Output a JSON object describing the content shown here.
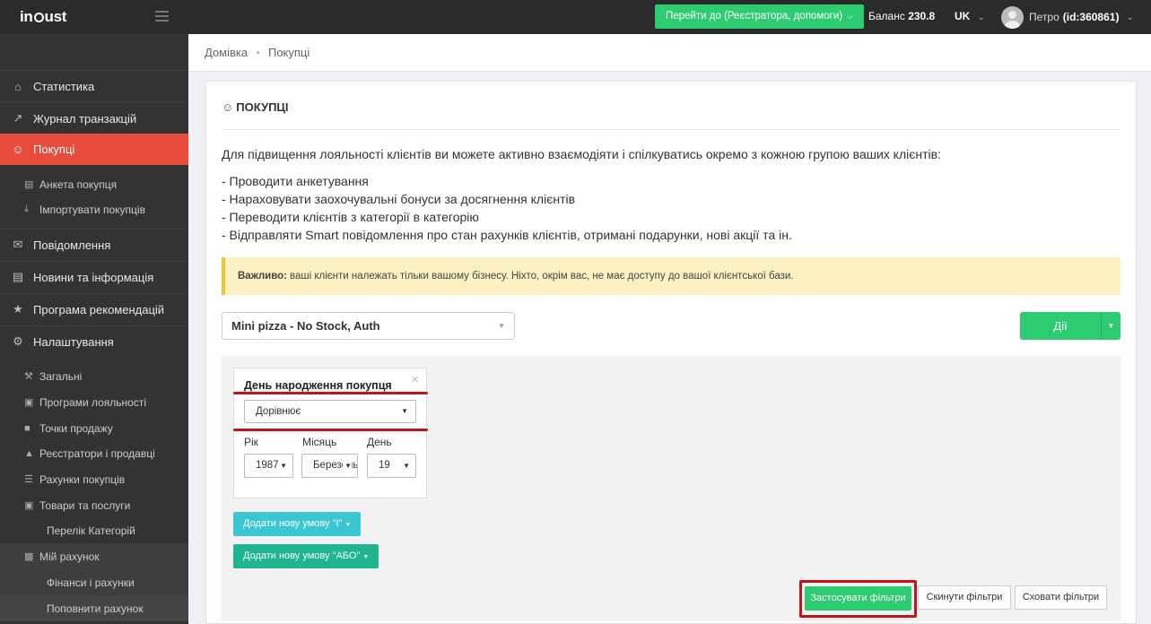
{
  "topbar": {
    "logo": "incust",
    "goto_label": "Перейти до (Реєстратора, допомоги)",
    "balance_label": "Баланс",
    "balance_value": "230.8",
    "lang": "UK",
    "user_name": "Петро",
    "user_id": "(id:360861)"
  },
  "sidebar": {
    "items": [
      {
        "label": "Статистика",
        "icon": "home-icon"
      },
      {
        "label": "Журнал транзакцій",
        "icon": "chart-line-icon"
      },
      {
        "label": "Покупці",
        "icon": "users-icon"
      },
      {
        "label": "Анкета покупця",
        "icon": "document-icon"
      },
      {
        "label": "Імпортувати покупців",
        "icon": "download-icon"
      },
      {
        "label": "Повідомлення",
        "icon": "message-icon"
      },
      {
        "label": "Новини та інформація",
        "icon": "newspaper-icon"
      },
      {
        "label": "Програма рекомендацій",
        "icon": "star-icon"
      },
      {
        "label": "Налаштування",
        "icon": "gear-icon"
      },
      {
        "label": "Загальні",
        "icon": "wrench-icon"
      },
      {
        "label": "Програми лояльності",
        "icon": "briefcase-icon"
      },
      {
        "label": "Точки продажу",
        "icon": "store-icon"
      },
      {
        "label": "Реєстратори і продавці",
        "icon": "cart-icon"
      },
      {
        "label": "Рахунки покупців",
        "icon": "list-icon"
      },
      {
        "label": "Товари та послуги",
        "icon": "gift-icon"
      },
      {
        "label": "Перелік Категорій",
        "icon": ""
      },
      {
        "label": "Мій рахунок",
        "icon": "money-icon"
      },
      {
        "label": "Фінанси і рахунки",
        "icon": ""
      },
      {
        "label": "Поповнити рахунок",
        "icon": ""
      }
    ]
  },
  "breadcrumb": {
    "home": "Домівка",
    "current": "Покупці"
  },
  "panel": {
    "title": "ПОКУПЦІ",
    "intro": "Для підвищення лояльності клієнтів ви можете активно взаємодіяти і спілкуватись окремо з кожною групою ваших клієнтів:",
    "bullets": [
      "- Проводити анкетування",
      "- Нараховувати заохочувальні бонуси за досягнення клієнтів",
      "- Переводити клієнтів з категорії в категорію",
      "- Відправляти Smart повідомлення про стан рахунків клієнтів, отримані подарунки, нові акції та ін."
    ],
    "alert_strong": "Важливо:",
    "alert_text": "ваші клієнти належать тільки вашому бізнесу. Ніхто, окрім вас, не має доступу до вашої клієнтської бази.",
    "business_select": "Mini pizza - No Stock, Auth",
    "actions_label": "Дії"
  },
  "filter": {
    "title": "День народження покупця",
    "condition": "Дорівнює",
    "year_label": "Рік",
    "month_label": "Місяць",
    "day_label": "День",
    "year_value": "1987",
    "month_value": "Березень",
    "day_value": "19",
    "add_and_label": "Додати нову умову \"І\"",
    "add_or_label": "Додати нову умову \"АБО\"",
    "apply_label": "Застосувати фільтри",
    "reset_label": "Скинути фільтри",
    "hide_label": "Сховати фільтри"
  },
  "colors": {
    "accent_green": "#2ecc71",
    "active_red": "#e74c3c",
    "highlight_red": "#c4141b",
    "alert_bg": "#fcf1c2"
  }
}
